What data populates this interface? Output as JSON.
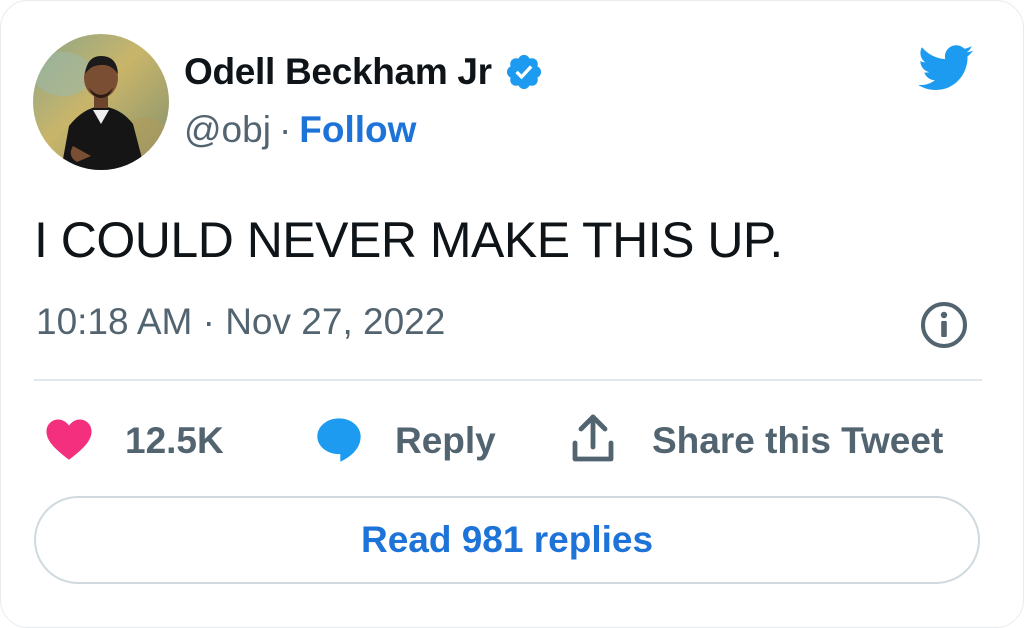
{
  "user": {
    "display_name": "Odell Beckham Jr",
    "handle": "@obj",
    "separator": "·",
    "follow_label": "Follow",
    "verified_icon": "verified-badge-icon"
  },
  "tweet": {
    "text": "I COULD NEVER MAKE THIS UP.",
    "timestamp": "10:18 AM · Nov 27, 2022"
  },
  "actions": {
    "likes_count": "12.5K",
    "reply_label": "Reply",
    "share_label": "Share this Tweet"
  },
  "footer": {
    "read_replies_label": "Read 981 replies"
  },
  "colors": {
    "twitter_blue": "#1d9bf0",
    "link_blue": "#1d73d8",
    "heart_pink": "#f4307e",
    "secondary_text": "#536471"
  }
}
